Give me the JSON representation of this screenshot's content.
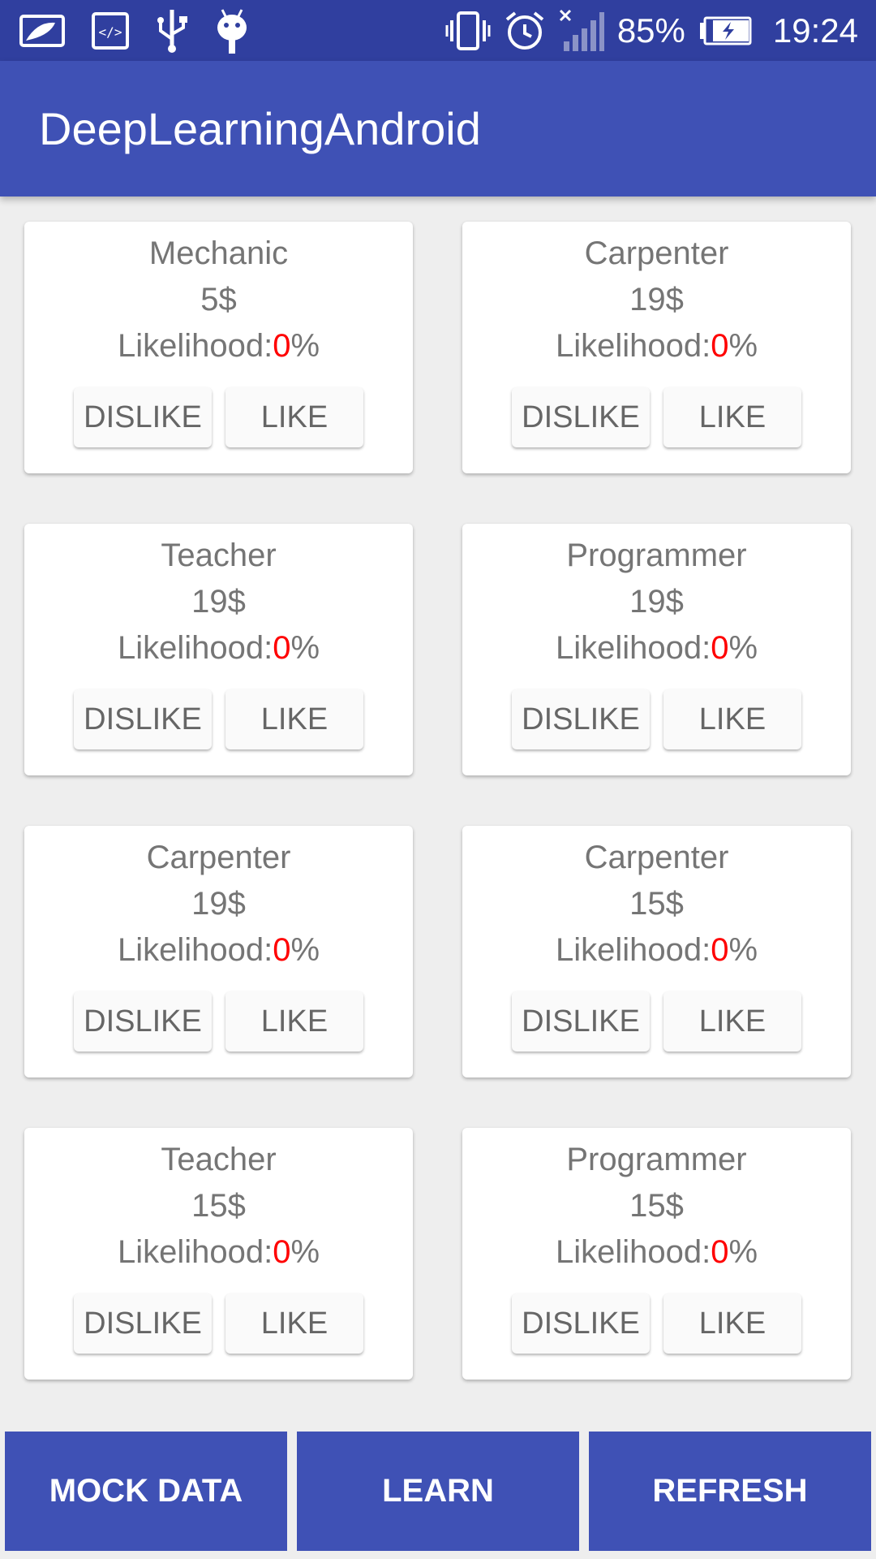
{
  "status_bar": {
    "battery": "85%",
    "time": "19:24",
    "icons": [
      "gallery-icon",
      "code-icon",
      "usb-icon",
      "android-icon",
      "vibrate-icon",
      "alarm-icon",
      "signal-icon",
      "battery-charging-icon"
    ]
  },
  "app_bar": {
    "title": "DeepLearningAndroid"
  },
  "colors": {
    "primary": "#3f51b5",
    "primary_dark": "#303f9f",
    "likelihood_value": "#ff0000"
  },
  "cards": [
    {
      "job": "Mechanic",
      "price": "5$",
      "likelihood_label": "Likelihood:",
      "likelihood_value": "0",
      "likelihood_unit": "%",
      "dislike": "DISLIKE",
      "like": "LIKE"
    },
    {
      "job": "Carpenter",
      "price": "19$",
      "likelihood_label": "Likelihood:",
      "likelihood_value": "0",
      "likelihood_unit": "%",
      "dislike": "DISLIKE",
      "like": "LIKE"
    },
    {
      "job": "Teacher",
      "price": "19$",
      "likelihood_label": "Likelihood:",
      "likelihood_value": "0",
      "likelihood_unit": "%",
      "dislike": "DISLIKE",
      "like": "LIKE"
    },
    {
      "job": "Programmer",
      "price": "19$",
      "likelihood_label": "Likelihood:",
      "likelihood_value": "0",
      "likelihood_unit": "%",
      "dislike": "DISLIKE",
      "like": "LIKE"
    },
    {
      "job": "Carpenter",
      "price": "19$",
      "likelihood_label": "Likelihood:",
      "likelihood_value": "0",
      "likelihood_unit": "%",
      "dislike": "DISLIKE",
      "like": "LIKE"
    },
    {
      "job": "Carpenter",
      "price": "15$",
      "likelihood_label": "Likelihood:",
      "likelihood_value": "0",
      "likelihood_unit": "%",
      "dislike": "DISLIKE",
      "like": "LIKE"
    },
    {
      "job": "Teacher",
      "price": "15$",
      "likelihood_label": "Likelihood:",
      "likelihood_value": "0",
      "likelihood_unit": "%",
      "dislike": "DISLIKE",
      "like": "LIKE"
    },
    {
      "job": "Programmer",
      "price": "15$",
      "likelihood_label": "Likelihood:",
      "likelihood_value": "0",
      "likelihood_unit": "%",
      "dislike": "DISLIKE",
      "like": "LIKE"
    }
  ],
  "bottom_buttons": {
    "mock_data": "MOCK DATA",
    "learn": "LEARN",
    "refresh": "REFRESH"
  }
}
